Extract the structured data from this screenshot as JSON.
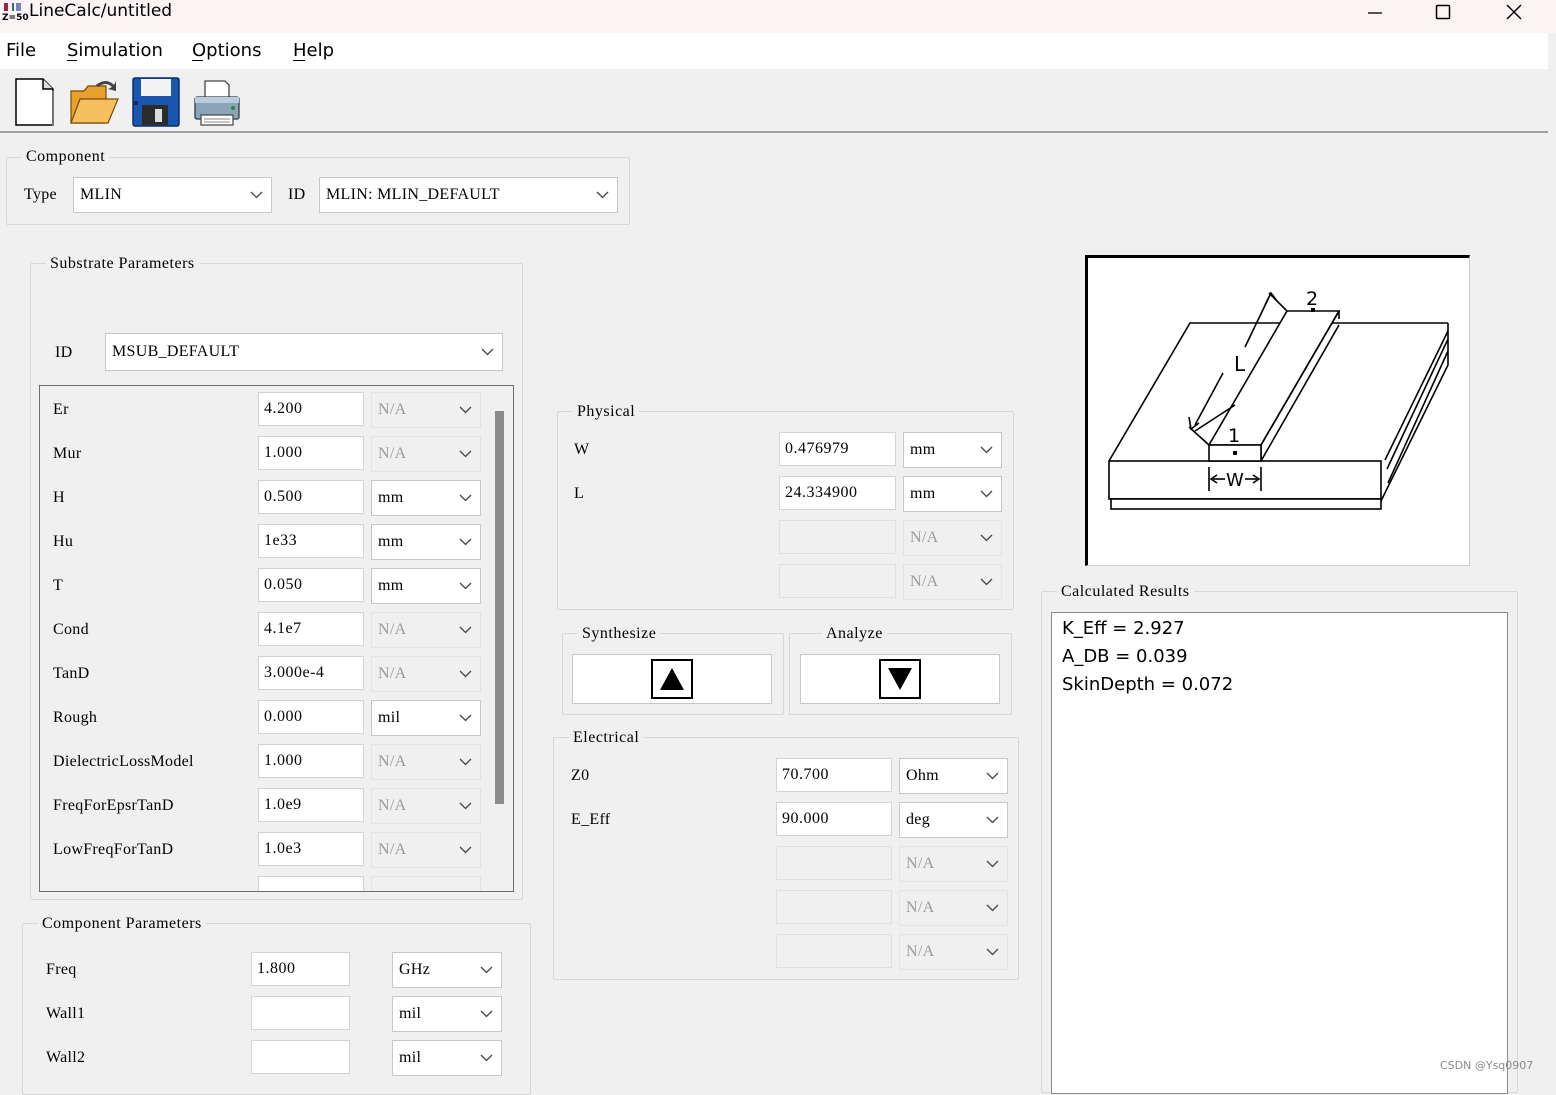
{
  "window": {
    "title": "LineCalc/untitled",
    "app_icon_text": "Z=50"
  },
  "menu": [
    "File",
    "Simulation",
    "Options",
    "Help"
  ],
  "toolbar_icons": [
    "new-file-icon",
    "open-folder-icon",
    "save-icon",
    "print-icon"
  ],
  "component": {
    "title": "Component",
    "type_label": "Type",
    "type_value": "MLIN",
    "id_label": "ID",
    "id_value": "MLIN: MLIN_DEFAULT"
  },
  "substrate": {
    "title": "Substrate Parameters",
    "id_label": "ID",
    "id_value": "MSUB_DEFAULT",
    "params": [
      {
        "name": "Er",
        "value": "4.200",
        "unit": "N/A",
        "unit_enabled": false
      },
      {
        "name": "Mur",
        "value": "1.000",
        "unit": "N/A",
        "unit_enabled": false
      },
      {
        "name": "H",
        "value": "0.500",
        "unit": "mm",
        "unit_enabled": true
      },
      {
        "name": "Hu",
        "value": "1e33",
        "unit": "mm",
        "unit_enabled": true
      },
      {
        "name": "T",
        "value": "0.050",
        "unit": "mm",
        "unit_enabled": true
      },
      {
        "name": "Cond",
        "value": "4.1e7",
        "unit": "N/A",
        "unit_enabled": false
      },
      {
        "name": "TanD",
        "value": "3.000e-4",
        "unit": "N/A",
        "unit_enabled": false
      },
      {
        "name": "Rough",
        "value": "0.000",
        "unit": "mil",
        "unit_enabled": true
      },
      {
        "name": "DielectricLossModel",
        "value": "1.000",
        "unit": "N/A",
        "unit_enabled": false
      },
      {
        "name": "FreqForEpsrTanD",
        "value": "1.0e9",
        "unit": "N/A",
        "unit_enabled": false
      },
      {
        "name": "LowFreqForTanD",
        "value": "1.0e3",
        "unit": "N/A",
        "unit_enabled": false
      }
    ]
  },
  "component_params": {
    "title": "Component Parameters",
    "params": [
      {
        "name": "Freq",
        "value": "1.800",
        "unit": "GHz"
      },
      {
        "name": "Wall1",
        "value": "",
        "unit": "mil"
      },
      {
        "name": "Wall2",
        "value": "",
        "unit": "mil"
      }
    ]
  },
  "physical": {
    "title": "Physical",
    "params": [
      {
        "name": "W",
        "value": "0.476979",
        "unit": "mm",
        "enabled": true
      },
      {
        "name": "L",
        "value": "24.334900",
        "unit": "mm",
        "enabled": true
      },
      {
        "name": "",
        "value": "",
        "unit": "N/A",
        "enabled": false
      },
      {
        "name": "",
        "value": "",
        "unit": "N/A",
        "enabled": false
      }
    ]
  },
  "actions": {
    "synthesize": "Synthesize",
    "analyze": "Analyze"
  },
  "electrical": {
    "title": "Electrical",
    "params": [
      {
        "name": "Z0",
        "value": "70.700",
        "unit": "Ohm",
        "enabled": true
      },
      {
        "name": "E_Eff",
        "value": "90.000",
        "unit": "deg",
        "enabled": true
      },
      {
        "name": "",
        "value": "",
        "unit": "N/A",
        "enabled": false
      },
      {
        "name": "",
        "value": "",
        "unit": "N/A",
        "enabled": false
      },
      {
        "name": "",
        "value": "",
        "unit": "N/A",
        "enabled": false
      }
    ]
  },
  "diagram": {
    "labels": [
      "L",
      "1",
      "2",
      "W"
    ]
  },
  "results": {
    "title": "Calculated Results",
    "lines": [
      "K_Eff = 2.927",
      "A_DB = 0.039",
      "SkinDepth = 0.072"
    ]
  },
  "watermark": "CSDN @Ysq0907",
  "colors": {
    "titlebar": "#fbf3f4",
    "panel": "#f0f0f0",
    "field": "#ffffff",
    "disabled_text": "#9a9a9a"
  }
}
